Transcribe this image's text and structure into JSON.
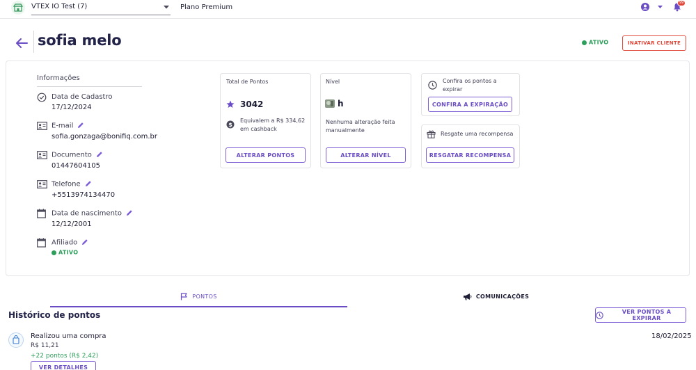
{
  "topbar": {
    "store_name": "VTEX IO Test (7)",
    "plan": "Plano Premium",
    "notification_count": "99"
  },
  "header": {
    "customer_name": "sofia melo",
    "status": "ATIVO",
    "inactivate_label": "INATIVAR CLIENTE"
  },
  "info": {
    "heading": "Informações",
    "fields": [
      {
        "label": "Data de Cadastro",
        "value": "17/12/2024",
        "icon": "check-circle-icon"
      },
      {
        "label": "E-mail",
        "value": "sofia.gonzaga@bonifiq.com.br",
        "icon": "id-card-icon"
      },
      {
        "label": "Documento",
        "value": "01447604105",
        "icon": "id-card-icon"
      },
      {
        "label": "Telefone",
        "value": "+5513974134470",
        "icon": "id-card-icon"
      },
      {
        "label": "Data de nascimento",
        "value": "12/12/2001",
        "icon": "calendar-icon"
      },
      {
        "label": "Afiliado",
        "value": "ATIVO",
        "icon": "calendar-icon"
      }
    ]
  },
  "points_card": {
    "title": "Total de Pontos",
    "points": "3042",
    "cashback_text": "Equivalem a R$ 334,62 em cashback",
    "button": "ALTERAR PONTOS"
  },
  "level_card": {
    "title": "Nível",
    "level": "h",
    "note": "Nenhuma alteração feita manualmente",
    "button": "ALTERAR NÍVEL"
  },
  "expire_card": {
    "text": "Confira os pontos a expirar",
    "button": "CONFIRA A EXPIRAÇÃO"
  },
  "reward_card": {
    "text": "Resgate uma recompensa",
    "button": "RESGATAR RECOMPENSA"
  },
  "tabs": [
    {
      "label": "PONTOS",
      "active": true
    },
    {
      "label": "COMUNICAÇÕES",
      "active": false
    }
  ],
  "history": {
    "title": "Histórico de pontos",
    "view_expire_label": "VER PONTOS A EXPIRAR",
    "entries": [
      {
        "title": "Realizou uma compra",
        "amount": "R$ 11,21",
        "points": "+22 pontos (R$ 2,42)",
        "date": "18/02/2025",
        "details_label": "VER DETALHES"
      }
    ]
  },
  "colors": {
    "accent": "#6a4cc4",
    "success": "#2e9e5b",
    "danger": "#e0483a",
    "title": "#23234a"
  }
}
